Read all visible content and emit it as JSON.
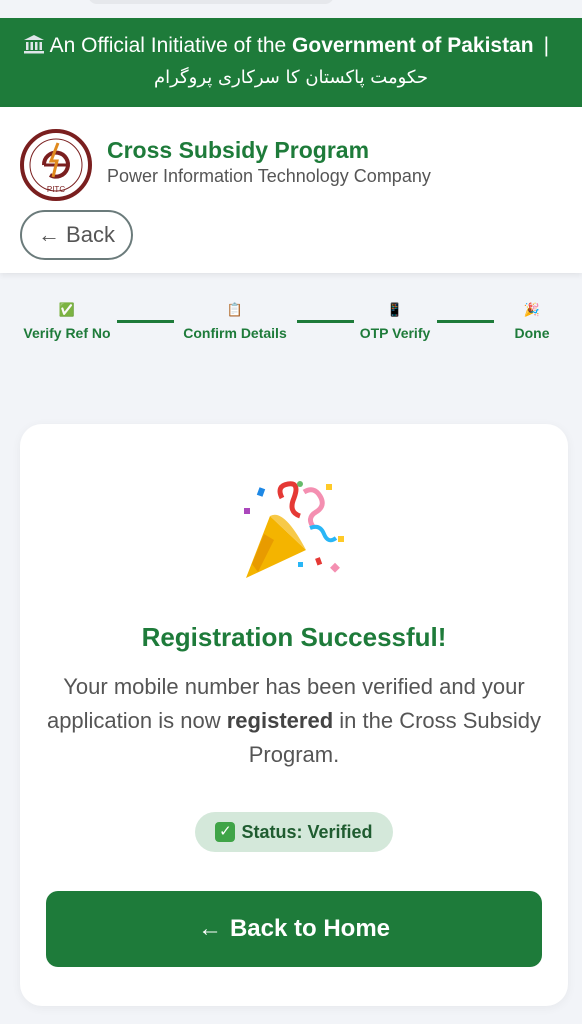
{
  "banner": {
    "prefix": "An Official Initiative of the",
    "bold": "Government of Pakistan",
    "separator": "|",
    "urdu": "حکومت پاکستان کا سرکاری پروگرام"
  },
  "header": {
    "logo_text": "PITC",
    "logo_ring_text": "POWER INFORMATION TECHNOLOGY COMPANY",
    "title": "Cross Subsidy Program",
    "subtitle": "Power Information Technology Company",
    "back_arrow": "←",
    "back_label": "Back"
  },
  "steps": [
    {
      "icon": "✅",
      "label": "Verify Ref No"
    },
    {
      "icon": "📋",
      "label": "Confirm Details"
    },
    {
      "icon": "📱",
      "label": "OTP Verify"
    },
    {
      "icon": "🎉",
      "label": "Done"
    }
  ],
  "result": {
    "title": "Registration Successful!",
    "message_part1": "Your mobile number has been verified and your application is now",
    "message_bold": "registered",
    "message_part2": "in the Cross Subsidy Program.",
    "status_check": "✓",
    "status": "Status: Verified",
    "home_arrow": "←",
    "home_button": "Back to Home"
  },
  "colors": {
    "primary": "#1e7b3a",
    "badge_bg": "#d4e8da",
    "page_bg": "#f2f4f8"
  }
}
